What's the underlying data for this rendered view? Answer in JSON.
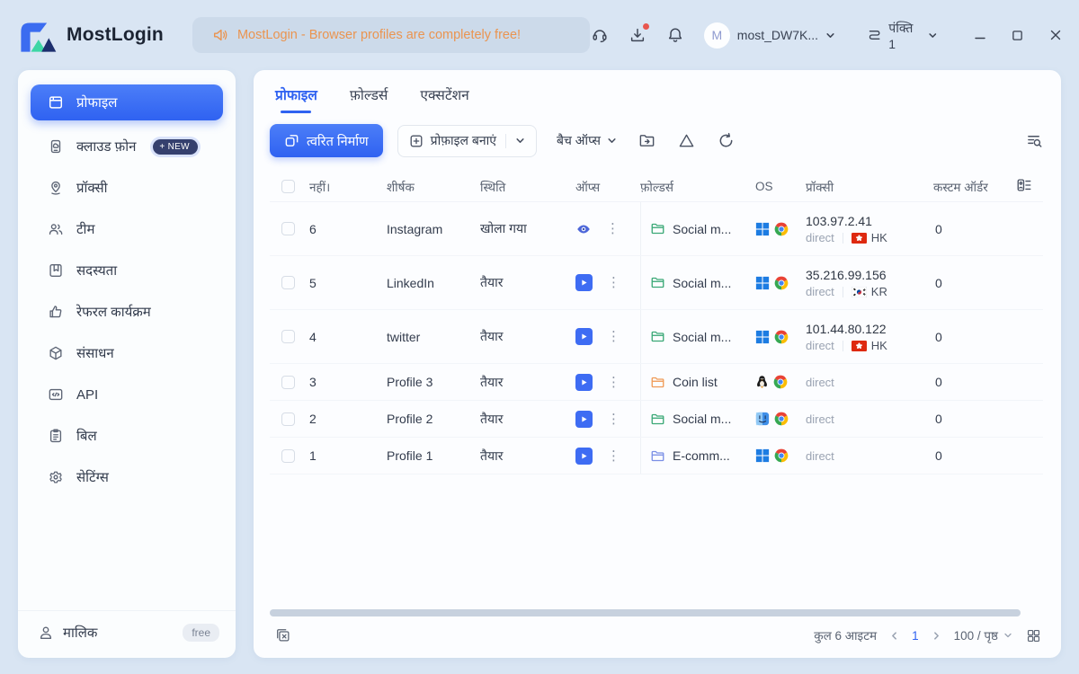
{
  "topbar": {
    "brand": "MostLogin",
    "banner": "MostLogin - Browser profiles are completely free!",
    "avatar_letter": "M",
    "account_name": "most_DW7K...",
    "row_selector": "पंक्ति 1"
  },
  "sidebar": {
    "items": [
      {
        "label": "प्रोफाइल",
        "icon": "profile-window-icon",
        "active": true
      },
      {
        "label": "क्लाउड फ़ोन",
        "icon": "cloud-phone-icon",
        "badge": "+ NEW"
      },
      {
        "label": "प्रॉक्सी",
        "icon": "proxy-pin-icon"
      },
      {
        "label": "टीम",
        "icon": "team-icon"
      },
      {
        "label": "सदस्यता",
        "icon": "membership-icon"
      },
      {
        "label": "रेफरल कार्यक्रम",
        "icon": "referral-thumbs-up-icon"
      },
      {
        "label": "संसाधन",
        "icon": "resources-box-icon"
      },
      {
        "label": "API",
        "icon": "api-icon"
      },
      {
        "label": "बिल",
        "icon": "bill-icon"
      },
      {
        "label": "सेटिंग्स",
        "icon": "settings-gear-icon"
      }
    ],
    "footer": {
      "label": "मालिक",
      "badge": "free"
    }
  },
  "main": {
    "tabs": [
      {
        "label": "प्रोफाइल",
        "active": true
      },
      {
        "label": "फ़ोल्डर्स",
        "active": false
      },
      {
        "label": "एक्सटेंशन",
        "active": false
      }
    ],
    "toolbar": {
      "quick_create": "त्वरित निर्माण",
      "create_profile": "प्रोफ़ाइल बनाएं",
      "batch_ops": "बैच ऑप्स"
    },
    "table": {
      "headers": [
        "नहीं।",
        "शीर्षक",
        "स्थिति",
        "ऑप्स",
        "फ़ोल्डर्स",
        "OS",
        "प्रॉक्सी",
        "कस्टम ऑर्डर"
      ],
      "rows": [
        {
          "no": "6",
          "title": "Instagram",
          "status": "खोला गया",
          "op": "eye",
          "folder": "Social m...",
          "folder_color": "#3aa876",
          "os": "windows",
          "proxy_ip": "103.97.2.41",
          "proxy_type": "direct",
          "country": "HK",
          "order": "0"
        },
        {
          "no": "5",
          "title": "LinkedIn",
          "status": "तैयार",
          "op": "play",
          "folder": "Social m...",
          "folder_color": "#3aa876",
          "os": "windows",
          "proxy_ip": "35.216.99.156",
          "proxy_type": "direct",
          "country": "KR",
          "order": "0"
        },
        {
          "no": "4",
          "title": "twitter",
          "status": "तैयार",
          "op": "play",
          "folder": "Social m...",
          "folder_color": "#3aa876",
          "os": "windows",
          "proxy_ip": "101.44.80.122",
          "proxy_type": "direct",
          "country": "HK",
          "order": "0"
        },
        {
          "no": "3",
          "title": "Profile 3",
          "status": "तैयार",
          "op": "play",
          "folder": "Coin list",
          "folder_color": "#f09a56",
          "os": "linux",
          "proxy_ip": "",
          "proxy_type": "direct",
          "country": "",
          "order": "0"
        },
        {
          "no": "2",
          "title": "Profile 2",
          "status": "तैयार",
          "op": "play",
          "folder": "Social m...",
          "folder_color": "#3aa876",
          "os": "mac",
          "proxy_ip": "",
          "proxy_type": "direct",
          "country": "",
          "order": "0"
        },
        {
          "no": "1",
          "title": "Profile 1",
          "status": "तैयार",
          "op": "play",
          "folder": "E-comm...",
          "folder_color": "#7a8fe6",
          "os": "windows",
          "proxy_ip": "",
          "proxy_type": "direct",
          "country": "",
          "order": "0"
        }
      ]
    },
    "pagination": {
      "total": "कुल 6 आइटम",
      "page": "1",
      "per_page": "100 / पृष्ठ"
    }
  },
  "colors": {
    "primary": "#2f62f1",
    "banner_text": "#ea9450",
    "page_bg": "#d9e5f3",
    "card_bg": "#fcfdff",
    "folder_green": "#3aa876",
    "folder_orange": "#f09a56",
    "folder_blue": "#7a8fe6"
  }
}
